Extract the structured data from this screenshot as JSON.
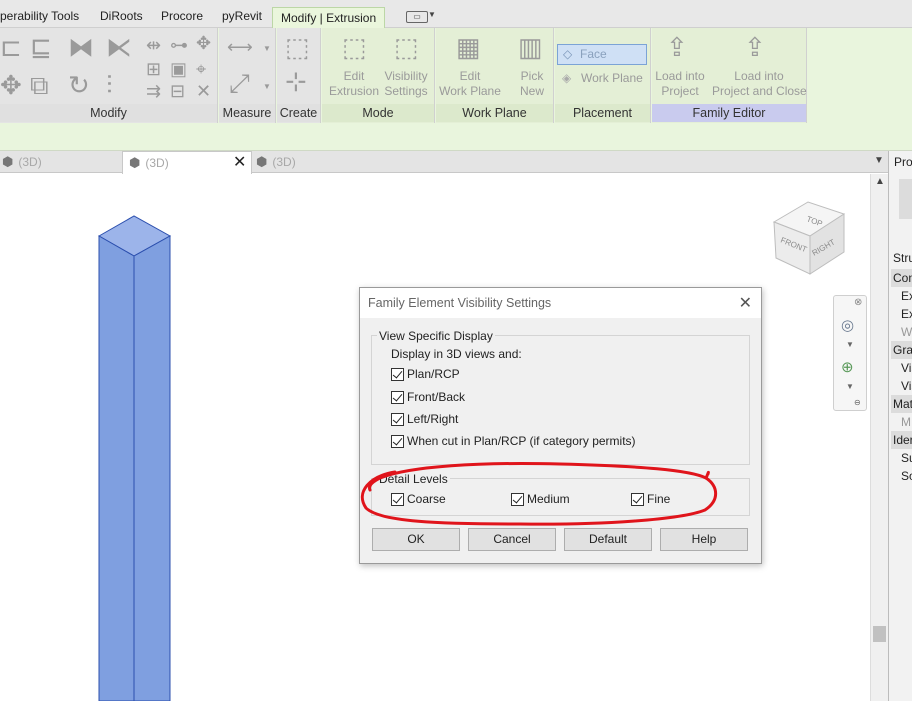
{
  "ribbon_tabs": [
    "perability Tools",
    "DiRoots",
    "Procore",
    "pyRevit",
    "Modify | Extrusion"
  ],
  "panels": {
    "modify": "Modify",
    "measure": "Measure",
    "create": "Create",
    "mode": "Mode",
    "work_plane": "Work Plane",
    "placement": "Placement",
    "family_editor": "Family Editor"
  },
  "buttons": {
    "edit_extrusion": [
      "Edit",
      "Extrusion"
    ],
    "visibility_settings": [
      "Visibility",
      "Settings"
    ],
    "edit_work_plane": [
      "Edit",
      "Work Plane"
    ],
    "pick_new": [
      "Pick",
      "New"
    ],
    "face": "Face",
    "work_plane": "Work Plane",
    "load_into_project": [
      "Load into",
      "Project"
    ],
    "load_into_project_close": [
      "Load into",
      "Project and Close"
    ]
  },
  "view_tabs": [
    {
      "label": "(3D)"
    },
    {
      "label": "(3D)"
    },
    {
      "label": "(3D)"
    }
  ],
  "viewcube": {
    "top": "TOP",
    "front": "FRONT",
    "right": "RIGHT"
  },
  "properties": {
    "title": "Pro",
    "rows": [
      {
        "text": "Stru",
        "kind": "header"
      },
      {
        "text": "Con",
        "kind": "cat"
      },
      {
        "text": "Ex",
        "kind": "sub"
      },
      {
        "text": "Ex",
        "kind": "sub"
      },
      {
        "text": "W",
        "kind": "grey"
      },
      {
        "text": "Gra",
        "kind": "cat"
      },
      {
        "text": "Vis",
        "kind": "sub"
      },
      {
        "text": "Vis",
        "kind": "sub"
      },
      {
        "text": "Mat",
        "kind": "cat"
      },
      {
        "text": "M",
        "kind": "grey"
      },
      {
        "text": "Ider",
        "kind": "cat"
      },
      {
        "text": "Su",
        "kind": "sub"
      },
      {
        "text": "So",
        "kind": "sub"
      }
    ]
  },
  "dialog": {
    "title": "Family Element Visibility Settings",
    "view_specific": {
      "label": "View Specific Display",
      "sub_label": "Display in 3D views and:",
      "options": [
        "Plan/RCP",
        "Front/Back",
        "Left/Right",
        "When cut in Plan/RCP (if category permits)"
      ]
    },
    "detail_levels": {
      "label": "Detail Levels",
      "options": [
        "Coarse",
        "Medium",
        "Fine"
      ]
    },
    "buttons": {
      "ok": "OK",
      "cancel": "Cancel",
      "default": "Default",
      "help": "Help"
    }
  },
  "colors": {
    "extrusion_fill": "#7f9fe0",
    "extrusion_top": "#9cb4ea",
    "extrusion_edge": "#2b4fae",
    "highlight_annotation": "#e0141b",
    "ribbon_green": "#e9f5dd",
    "family_editor_label": "#c9cbee"
  }
}
